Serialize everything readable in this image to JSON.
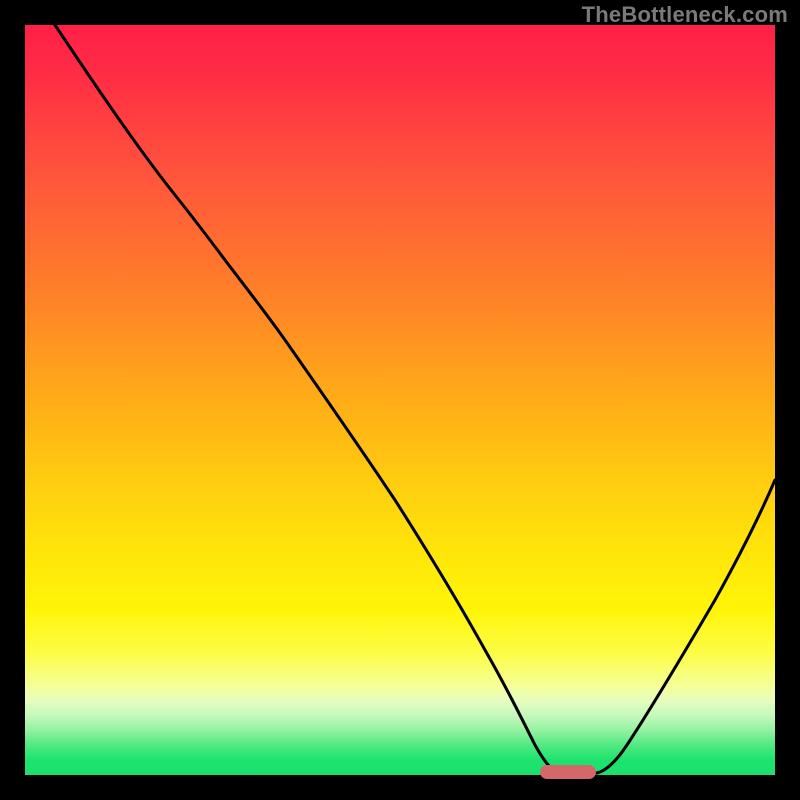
{
  "watermark": "TheBottleneck.com",
  "chart_data": {
    "type": "line",
    "title": "",
    "xlabel": "",
    "ylabel": "",
    "xlim": [
      0,
      100
    ],
    "ylim": [
      0,
      100
    ],
    "background_gradient": {
      "orientation": "vertical",
      "top_color": "#ff2046",
      "bottom_color": "#1be06d",
      "stops": [
        {
          "pos": 0.0,
          "color": "#ff2046"
        },
        {
          "pos": 0.3,
          "color": "#ff7030"
        },
        {
          "pos": 0.62,
          "color": "#ffd010"
        },
        {
          "pos": 0.88,
          "color": "#f6fe96"
        },
        {
          "pos": 1.0,
          "color": "#1be06d"
        }
      ]
    },
    "series": [
      {
        "name": "bottleneck-curve",
        "x": [
          4,
          10,
          18,
          23,
          28,
          34,
          40,
          46,
          52,
          58,
          62,
          64,
          66,
          70,
          74,
          78,
          83,
          88,
          93,
          98,
          100
        ],
        "y": [
          100,
          92,
          80,
          73,
          67,
          60,
          52,
          44,
          35,
          25,
          16,
          10,
          5,
          1,
          0,
          1,
          6,
          14,
          24,
          36,
          43
        ]
      }
    ],
    "marker": {
      "name": "optimal-range",
      "shape": "pill",
      "x_center": 72,
      "y": 0,
      "width": 7,
      "color": "#d4676a"
    }
  }
}
